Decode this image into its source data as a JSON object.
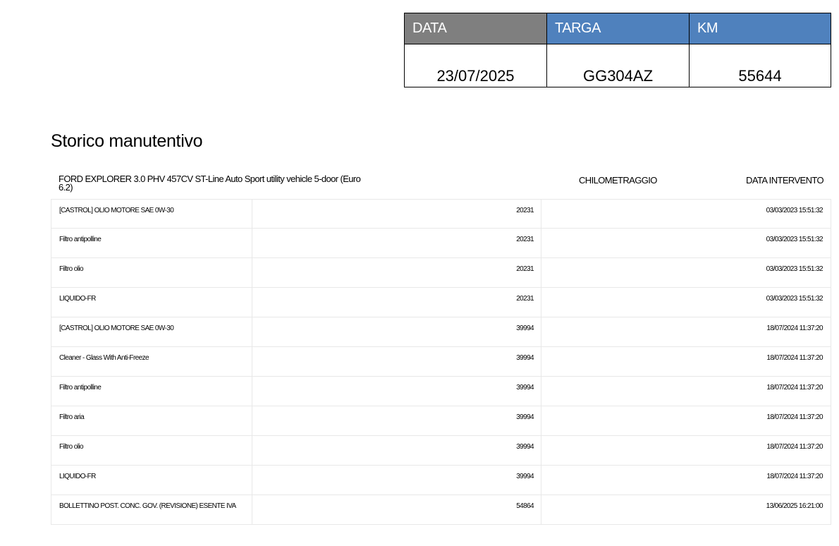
{
  "header_box": {
    "labels": {
      "data": "DATA",
      "targa": "TARGA",
      "km": "KM"
    },
    "values": {
      "data": "23/07/2025",
      "targa": "GG304AZ",
      "km": "55644"
    },
    "colors": {
      "data_header_bg": "#7f7f7f",
      "targa_header_bg": "#4f81bd",
      "km_header_bg": "#4f81bd"
    }
  },
  "section_title": "Storico manutentivo",
  "table": {
    "vehicle_title": "FORD EXPLORER 3.0 PHV 457CV ST-Line Auto Sport utility vehicle 5-door (Euro 6.2)",
    "col_km_header": "CHILOMETRAGGIO",
    "col_date_header": "DATA INTERVENTO",
    "rows": [
      {
        "desc": "[CASTROL] OLIO MOTORE SAE 0W-30",
        "km": "20231",
        "date": "03/03/2023 15:51:32"
      },
      {
        "desc": "Filtro antipolline",
        "km": "20231",
        "date": "03/03/2023 15:51:32"
      },
      {
        "desc": "Filtro olio",
        "km": "20231",
        "date": "03/03/2023 15:51:32"
      },
      {
        "desc": "LIQUIDO-FR",
        "km": "20231",
        "date": "03/03/2023 15:51:32"
      },
      {
        "desc": "[CASTROL] OLIO MOTORE SAE 0W-30",
        "km": "39994",
        "date": "18/07/2024 11:37:20"
      },
      {
        "desc": "Cleaner - Glass With Anti-Freeze",
        "km": "39994",
        "date": "18/07/2024 11:37:20"
      },
      {
        "desc": "Filtro antipolline",
        "km": "39994",
        "date": "18/07/2024 11:37:20"
      },
      {
        "desc": "Filtro aria",
        "km": "39994",
        "date": "18/07/2024 11:37:20"
      },
      {
        "desc": "Filtro olio",
        "km": "39994",
        "date": "18/07/2024 11:37:20"
      },
      {
        "desc": "LIQUIDO-FR",
        "km": "39994",
        "date": "18/07/2024 11:37:20"
      },
      {
        "desc": "BOLLETTINO POST. CONC. GOV. (REVISIONE) ESENTE IVA",
        "km": "54864",
        "date": "13/06/2025 16:21:00"
      }
    ]
  }
}
